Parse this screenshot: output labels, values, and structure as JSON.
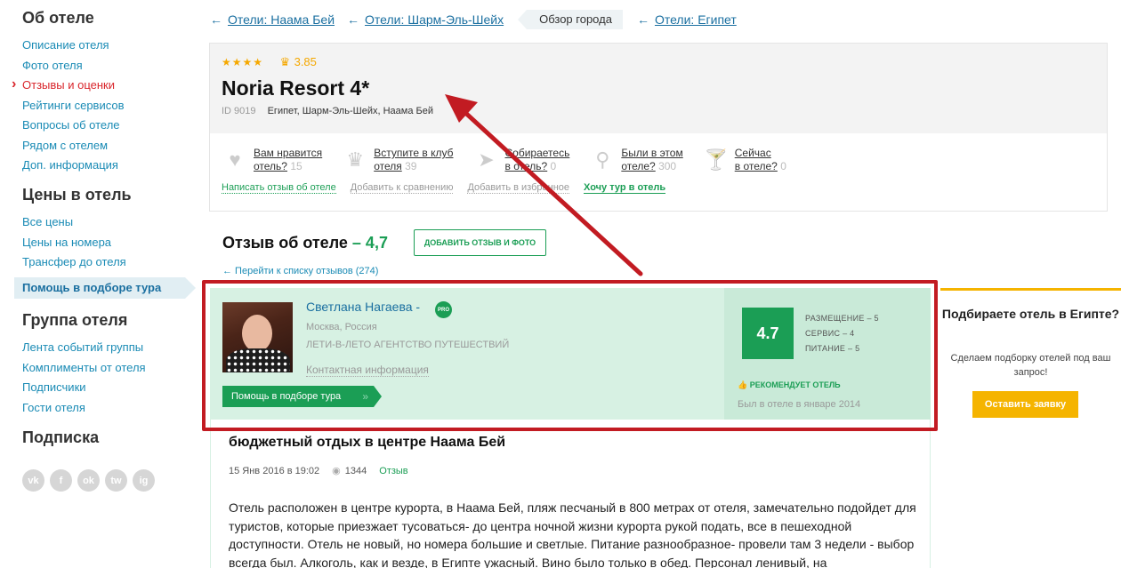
{
  "sidebar": {
    "sections": [
      {
        "title": "Об отеле",
        "items": [
          "Описание отеля",
          "Фото отеля",
          "Отзывы и оценки",
          "Рейтинги сервисов",
          "Вопросы об отеле",
          "Рядом с отелем",
          "Доп. информация"
        ]
      },
      {
        "title": "Цены в отель",
        "items": [
          "Все цены",
          "Цены на номера",
          "Трансфер до отеля"
        ],
        "highlight": "Помощь в подборе тура"
      },
      {
        "title": "Группа отеля",
        "items": [
          "Лента событий группы",
          "Комплименты от отеля",
          "Подписчики",
          "Гости отеля"
        ]
      },
      {
        "title": "Подписка"
      }
    ],
    "social": [
      "vk",
      "f",
      "ok",
      "tw",
      "ig"
    ]
  },
  "breadcrumbs": {
    "c1": "Отели: Наама Бей",
    "c2": "Отели: Шарм-Эль-Шейх",
    "tag": "Обзор города",
    "c3": "Отели: Египет"
  },
  "hotel": {
    "stars": "★★★★",
    "crown": "♛",
    "rating": "3.85",
    "name": "Noria Resort 4*",
    "id": "ID 9019",
    "location": "Египет, Шарм-Эль-Шейх, Наама Бей",
    "actions": [
      {
        "l1": "Вам нравится",
        "l2": "отель?",
        "count": "15"
      },
      {
        "l1": "Вступите в клуб",
        "l2": "отеля",
        "count": "39"
      },
      {
        "l1": "Собираетесь",
        "l2": "в отель?",
        "count": "0"
      },
      {
        "l1": "Были в этом",
        "l2": "отеле?",
        "count": "300"
      },
      {
        "l1": "Сейчас",
        "l2": "в отеле?",
        "count": "0"
      }
    ],
    "links": {
      "write": "Написать отзыв об отеле",
      "compare": "Добавить к сравнению",
      "fav": "Добавить в избранное",
      "tour": "Хочу тур в отель"
    }
  },
  "review": {
    "heading": "Отзыв об отеле",
    "heading_score": "– 4,7",
    "add_button": "ДОБАВИТЬ ОТЗЫВ И ФОТО",
    "back_link": "← Перейти к списку отзывов (274)",
    "author": {
      "name": "Светлана Нагаева -",
      "badge": "PRO",
      "city": "Москва, Россия",
      "agency": "ЛЕТИ-В-ЛЕТО АГЕНТСТВО ПУТЕШЕСТВИЙ",
      "contact": "Контактная информация",
      "help_button": "Помощь в подборе тура"
    },
    "score": "4.7",
    "subscores": {
      "s1": "РАЗМЕЩЕНИЕ – 5",
      "s2": "СЕРВИС – 4",
      "s3": "ПИТАНИЕ – 5"
    },
    "recommend": "РЕКОМЕНДУЕТ ОТЕЛЬ",
    "visited": "Был в отеле в январе 2014",
    "title": "бюджетный отдых в центре Наама Бей",
    "date": "15 Янв 2016 в 19:02",
    "views": "1344",
    "type": "Отзыв",
    "text": "Отель расположен в центре курорта, в Наама Бей, пляж песчаный в 800 метрах от отеля, замечательно подойдет для туристов, которые приезжает тусоваться- до центра ночной жизни курорта рукой подать, все в пешеходной доступности. Отель не новый, но номера большие и светлые. Питание разнообразное- провели там 3 недели - выбор всегда был. Алкоголь, как и везде, в Египте ужасный. Вино было только в обед. Персонал ленивый, на"
  },
  "promo": {
    "title": "Подбираете отель в Египте?",
    "subtitle": "Сделаем подборку отелей под ваш запрос!",
    "button": "Оставить заявку"
  },
  "colors": {
    "link": "#1a6fa0",
    "green": "#1b9e55",
    "red": "#c21b22",
    "yellow": "#f5b400"
  }
}
